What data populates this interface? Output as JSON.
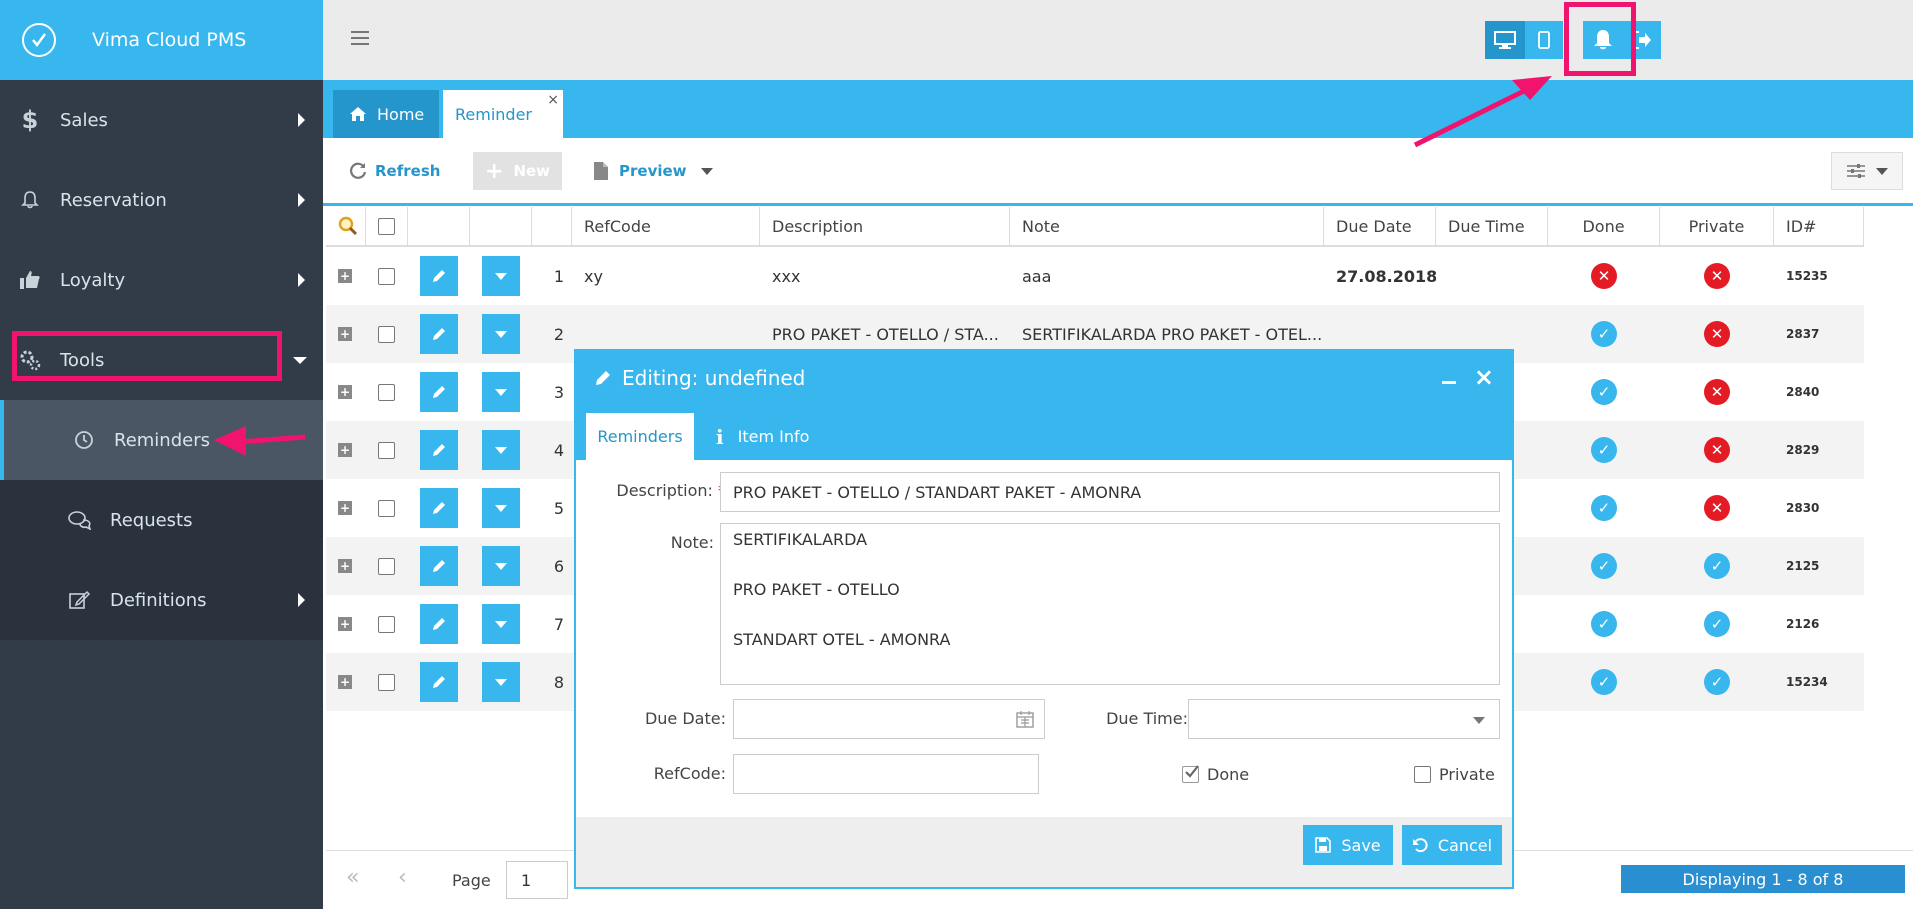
{
  "app": {
    "title": "Vima Cloud PMS"
  },
  "sidebar": {
    "items": [
      {
        "label": "Sales"
      },
      {
        "label": "Reservation"
      },
      {
        "label": "Loyalty"
      },
      {
        "label": "Tools"
      },
      {
        "label": "Reminders"
      },
      {
        "label": "Requests"
      },
      {
        "label": "Definitions"
      }
    ]
  },
  "tabs": {
    "home": "Home",
    "reminder": "Reminder",
    "close": "×"
  },
  "toolbar": {
    "refresh": "Refresh",
    "new": "New",
    "preview": "Preview"
  },
  "grid": {
    "columns": [
      "RefCode",
      "Description",
      "Note",
      "Due Date",
      "Due Time",
      "Done",
      "Private",
      "ID#"
    ],
    "rows": [
      {
        "n": "1",
        "ref": "xy",
        "desc": "xxx",
        "note": "aaa",
        "due": "27.08.2018",
        "time": "",
        "done": false,
        "priv": false,
        "id": "15235"
      },
      {
        "n": "2",
        "ref": "",
        "desc": "PRO PAKET - OTELLO / STA...",
        "note": "SERTIFIKALARDA PRO PAKET - OTEL...",
        "due": "",
        "time": "",
        "done": true,
        "priv": false,
        "id": "2837"
      },
      {
        "n": "3",
        "ref": "",
        "desc": "",
        "note": "",
        "due": "",
        "time": "",
        "done": true,
        "priv": false,
        "id": "2840"
      },
      {
        "n": "4",
        "ref": "",
        "desc": "",
        "note": "",
        "due": "",
        "time": "",
        "done": true,
        "priv": false,
        "id": "2829"
      },
      {
        "n": "5",
        "ref": "",
        "desc": "",
        "note": "",
        "due": "",
        "time": "",
        "done": true,
        "priv": false,
        "id": "2830"
      },
      {
        "n": "6",
        "ref": "",
        "desc": "",
        "note": "",
        "due": "",
        "time": "",
        "done": true,
        "priv": true,
        "id": "2125"
      },
      {
        "n": "7",
        "ref": "",
        "desc": "",
        "note": "",
        "due": "",
        "time": "",
        "done": true,
        "priv": true,
        "id": "2126"
      },
      {
        "n": "8",
        "ref": "",
        "desc": "",
        "note": "",
        "due": "",
        "time": "",
        "done": true,
        "priv": true,
        "id": "15234"
      }
    ]
  },
  "pager": {
    "page_label": "Page",
    "page_value": "1",
    "displaying": "Displaying 1 - 8 of 8"
  },
  "dialog": {
    "title": "Editing: undefined",
    "tab_reminders": "Reminders",
    "tab_info": "Item Info",
    "description_label": "Description:",
    "description_value": "PRO PAKET - OTELLO / STANDART PAKET - AMONRA",
    "note_label": "Note:",
    "note_lines": [
      "SERTIFIKALARDA",
      "PRO PAKET - OTELLO",
      "STANDART OTEL - AMONRA"
    ],
    "due_date_label": "Due Date:",
    "due_time_label": "Due Time:",
    "refcode_label": "RefCode:",
    "done_label": "Done",
    "private_label": "Private",
    "save": "Save",
    "cancel": "Cancel"
  },
  "colors": {
    "accent": "#38b6ee",
    "highlight": "#f0146e",
    "sidebar": "#313c48"
  }
}
